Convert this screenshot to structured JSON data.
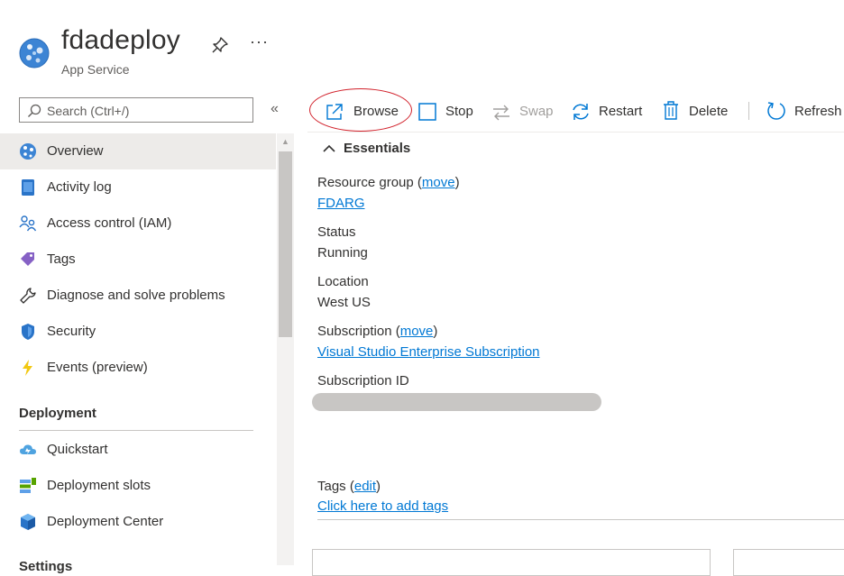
{
  "header": {
    "title": "fdadeploy",
    "subtitle": "App Service",
    "pin_icon": "pin-icon",
    "more_label": "···"
  },
  "sidebar": {
    "search_placeholder": "Search (Ctrl+/)",
    "collapse_label": "«",
    "items": [
      {
        "label": "Overview",
        "icon": "globe-icon"
      },
      {
        "label": "Activity log",
        "icon": "activity-log-icon"
      },
      {
        "label": "Access control (IAM)",
        "icon": "people-icon"
      },
      {
        "label": "Tags",
        "icon": "tag-icon"
      },
      {
        "label": "Diagnose and solve problems",
        "icon": "wrench-icon"
      },
      {
        "label": "Security",
        "icon": "shield-icon"
      },
      {
        "label": "Events (preview)",
        "icon": "lightning-icon"
      }
    ],
    "deployment_header": "Deployment",
    "deployment_items": [
      {
        "label": "Quickstart",
        "icon": "cloud-icon"
      },
      {
        "label": "Deployment slots",
        "icon": "slots-icon"
      },
      {
        "label": "Deployment Center",
        "icon": "cube-icon"
      }
    ],
    "settings_header": "Settings"
  },
  "toolbar": {
    "browse": "Browse",
    "stop": "Stop",
    "swap": "Swap",
    "restart": "Restart",
    "delete": "Delete",
    "refresh": "Refresh"
  },
  "essentials": {
    "title": "Essentials",
    "resource_group_label": "Resource group",
    "move_link": "move",
    "resource_group_value": "FDARG",
    "status_label": "Status",
    "status_value": "Running",
    "location_label": "Location",
    "location_value": "West US",
    "subscription_label": "Subscription",
    "subscription_value": "Visual Studio Enterprise Subscription",
    "subscription_id_label": "Subscription ID",
    "tags_label": "Tags",
    "edit_link": "edit",
    "tags_value": "Click here to add tags"
  },
  "colors": {
    "accent": "#0078d4",
    "annotation_circle": "#d1202a",
    "active_bg": "#edebe9"
  }
}
